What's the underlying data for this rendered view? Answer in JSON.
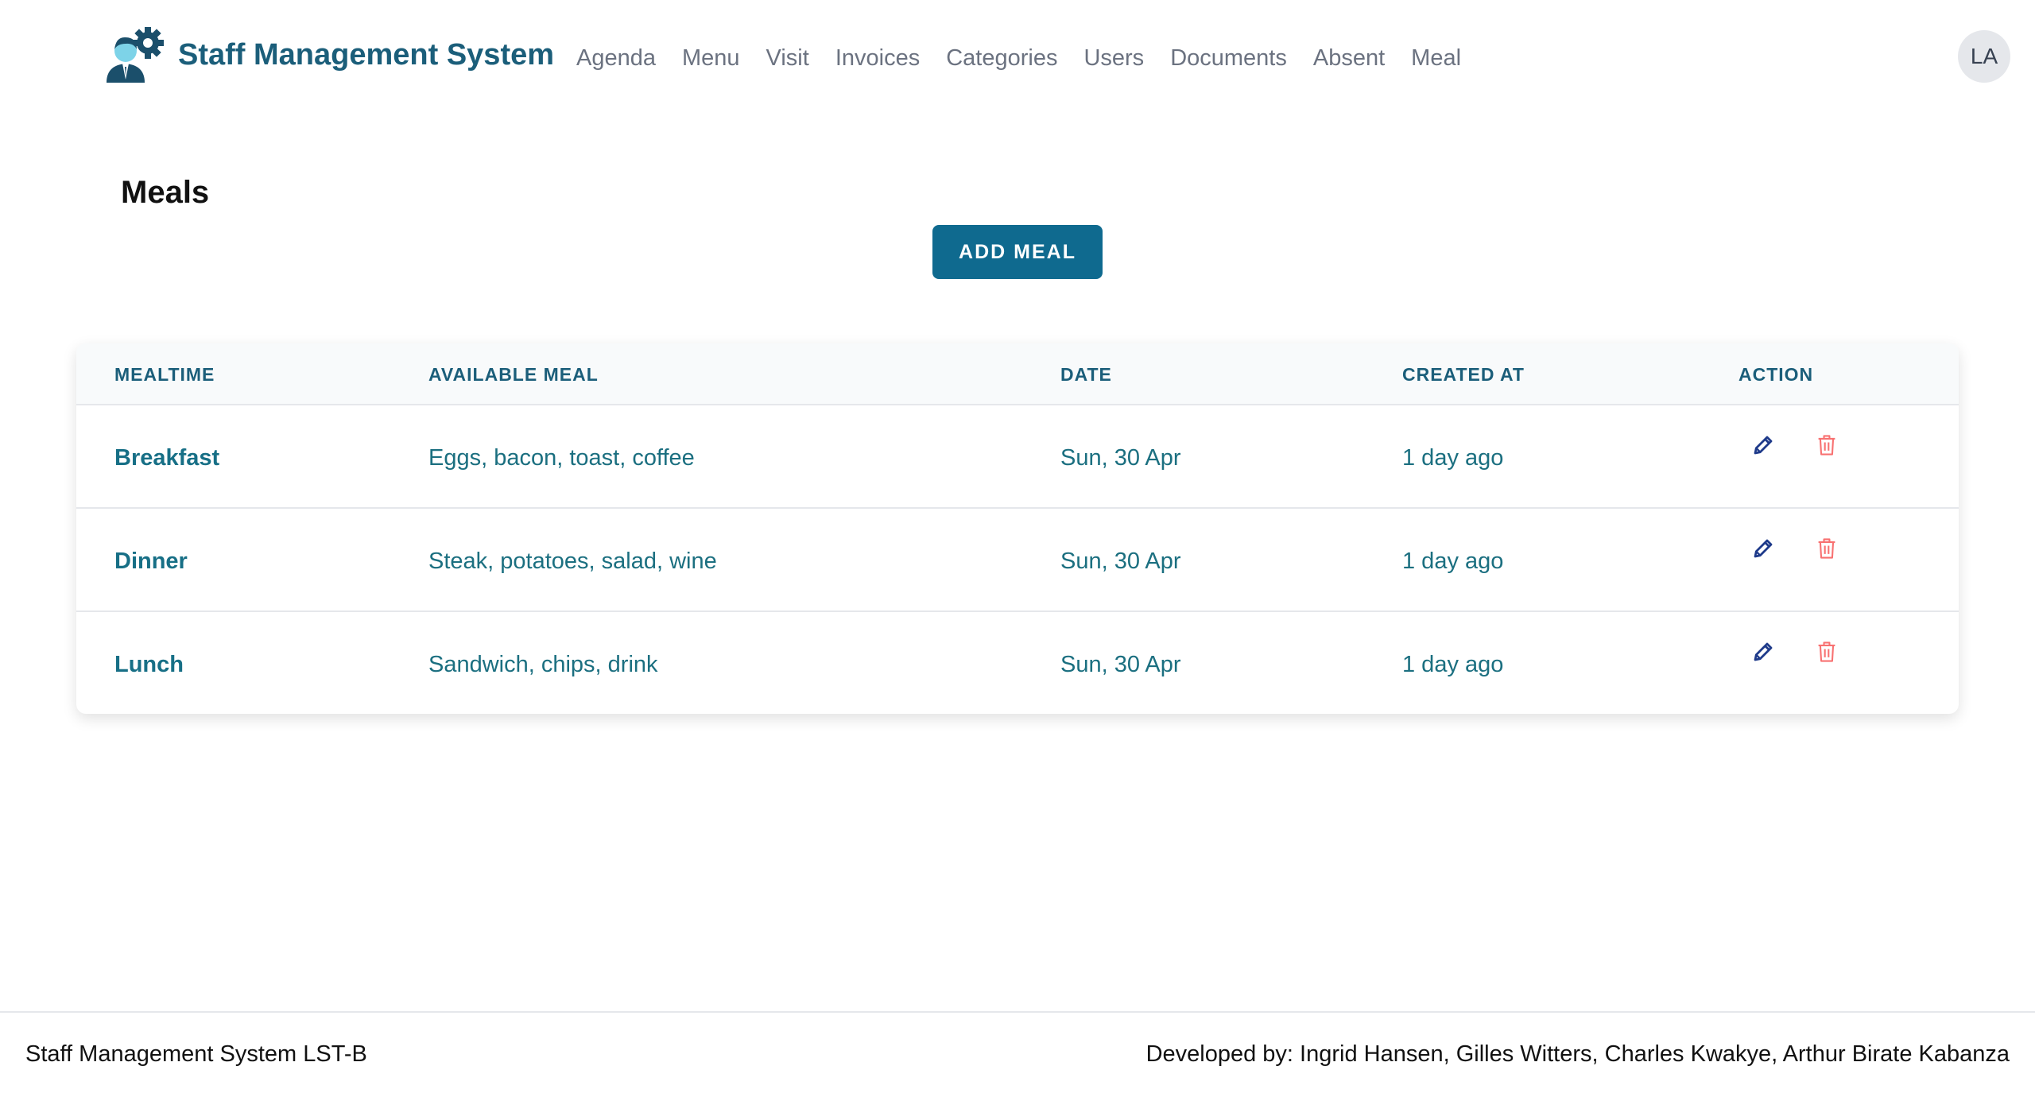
{
  "header": {
    "brand": "Staff Management System",
    "nav": [
      "Agenda",
      "Menu",
      "Visit",
      "Invoices",
      "Categories",
      "Users",
      "Documents",
      "Absent",
      "Meal"
    ],
    "avatar": "LA"
  },
  "page": {
    "title": "Meals",
    "add_button": "ADD MEAL"
  },
  "table": {
    "headers": [
      "MEALTIME",
      "AVAILABLE MEAL",
      "DATE",
      "CREATED AT",
      "ACTION"
    ],
    "rows": [
      {
        "mealtime": "Breakfast",
        "meal": "Eggs, bacon, toast, coffee",
        "date": "Sun, 30 Apr",
        "created": "1 day ago"
      },
      {
        "mealtime": "Dinner",
        "meal": "Steak, potatoes, salad, wine",
        "date": "Sun, 30 Apr",
        "created": "1 day ago"
      },
      {
        "mealtime": "Lunch",
        "meal": "Sandwich, chips, drink",
        "date": "Sun, 30 Apr",
        "created": "1 day ago"
      }
    ],
    "action_icons": [
      "pencil-icon",
      "trash-icon"
    ]
  },
  "colors": {
    "brand": "#1b5e7a",
    "button": "#0f6a8f",
    "edit_icon": "#1e3a8a",
    "delete_icon": "#f87171"
  },
  "footer": {
    "left": "Staff Management System LST-B",
    "right": "Developed by: Ingrid Hansen, Gilles Witters, Charles Kwakye, Arthur Birate Kabanza"
  }
}
